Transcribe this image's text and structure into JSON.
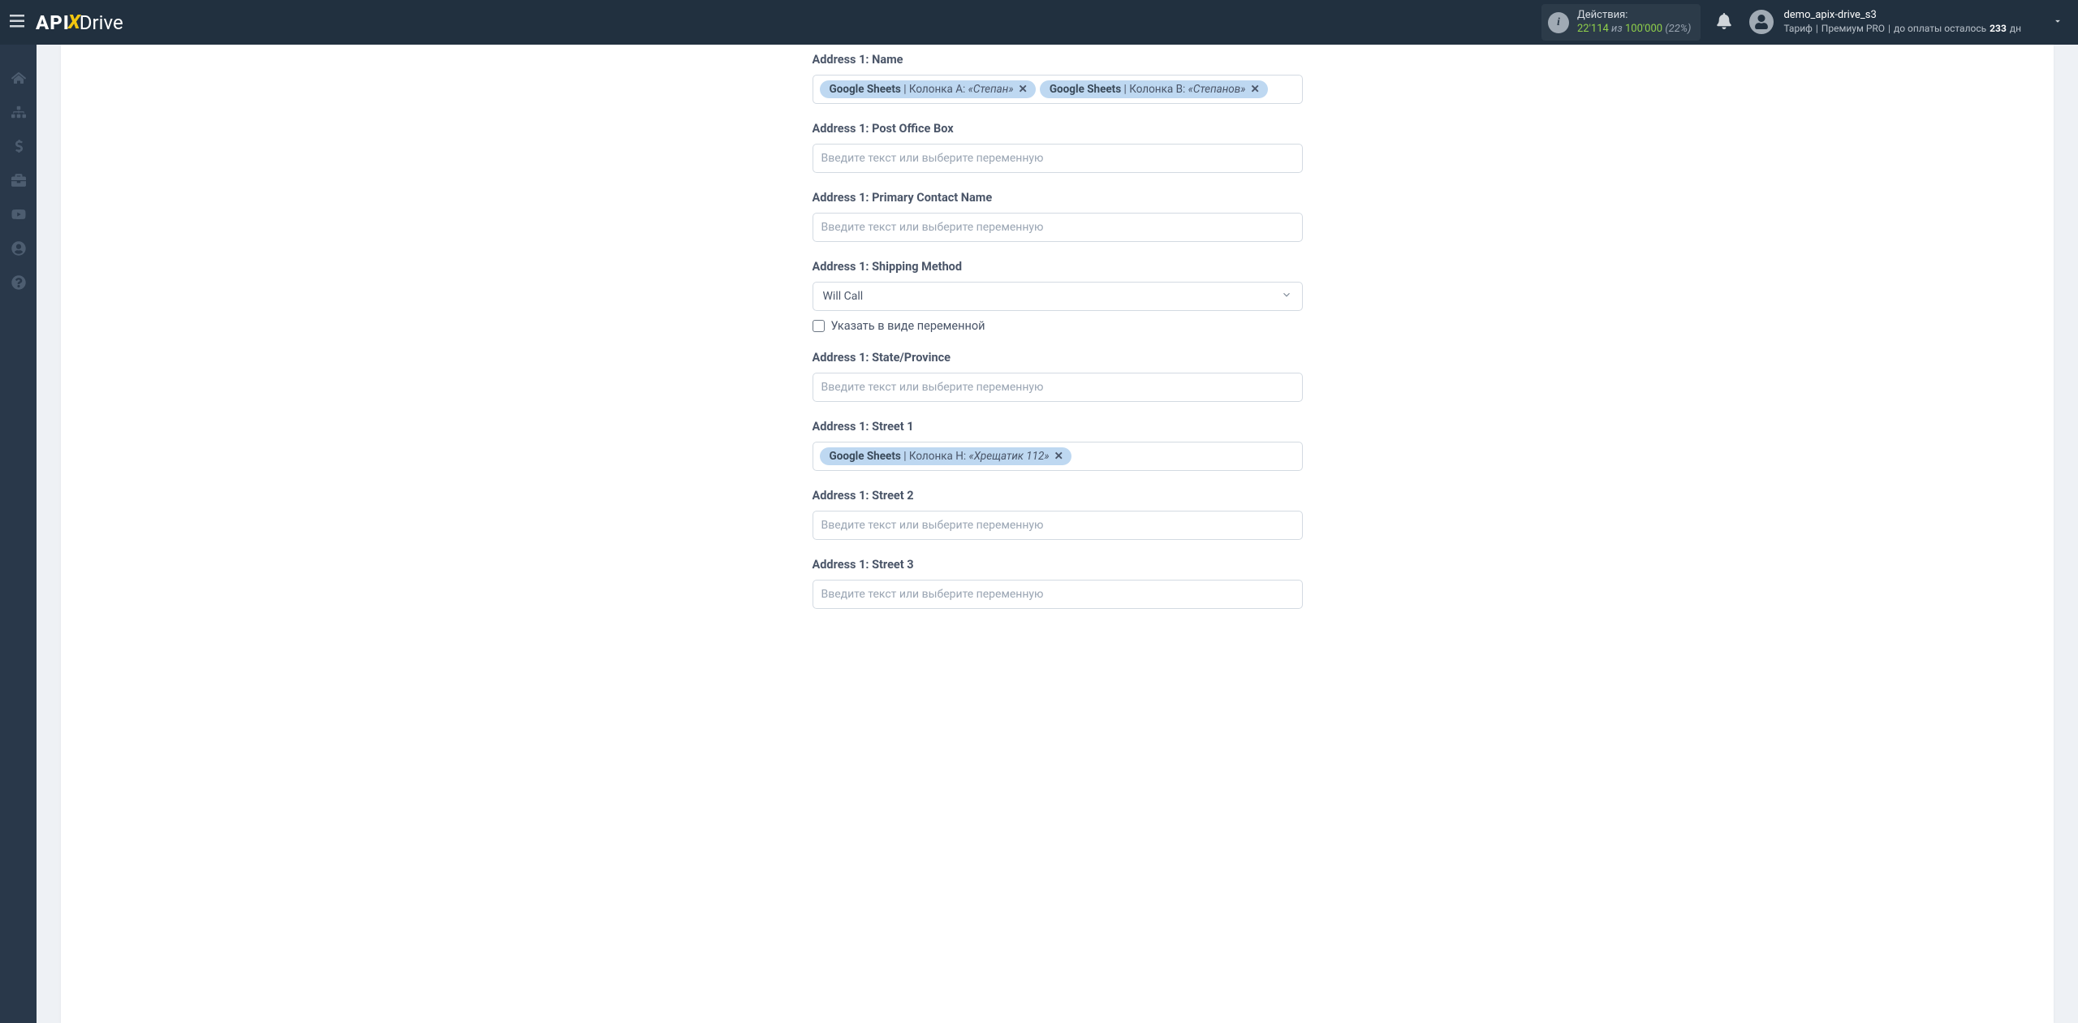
{
  "header": {
    "logo_api": "API",
    "logo_x": "X",
    "logo_drive": "Drive",
    "actions_label": "Действия:",
    "actions_count": "22'114",
    "actions_of": "из",
    "actions_limit": "100'000",
    "actions_pct": "(22%)",
    "username": "demo_apix-drive_s3",
    "tariff_label": "Тариф",
    "tariff_sep": "|",
    "tariff_name": "Премиум PRO",
    "tariff_sep2": "|",
    "payment_prefix": "до оплаты осталось",
    "payment_days": "233",
    "payment_suffix": "дн"
  },
  "sidebar": {
    "icons": [
      "home",
      "sitemap",
      "dollar",
      "briefcase",
      "youtube",
      "user",
      "question"
    ]
  },
  "form": {
    "placeholder": "Введите текст или выберите переменную",
    "checkbox_label": "Указать в виде переменной",
    "fields": {
      "name": {
        "label": "Address 1: Name",
        "tags": [
          {
            "source": "Google Sheets",
            "col": "Колонка A:",
            "val": "«Степан»"
          },
          {
            "source": "Google Sheets",
            "col": "Колонка B:",
            "val": "«Степанов»"
          }
        ]
      },
      "pobox": {
        "label": "Address 1: Post Office Box"
      },
      "primary_contact": {
        "label": "Address 1: Primary Contact Name"
      },
      "shipping": {
        "label": "Address 1: Shipping Method",
        "selected": "Will Call"
      },
      "state": {
        "label": "Address 1: State/Province"
      },
      "street1": {
        "label": "Address 1: Street 1",
        "tags": [
          {
            "source": "Google Sheets",
            "col": "Колонка H:",
            "val": "«Хрещатик 112»"
          }
        ]
      },
      "street2": {
        "label": "Address 1: Street 2"
      },
      "street3": {
        "label": "Address 1: Street 3"
      }
    }
  }
}
